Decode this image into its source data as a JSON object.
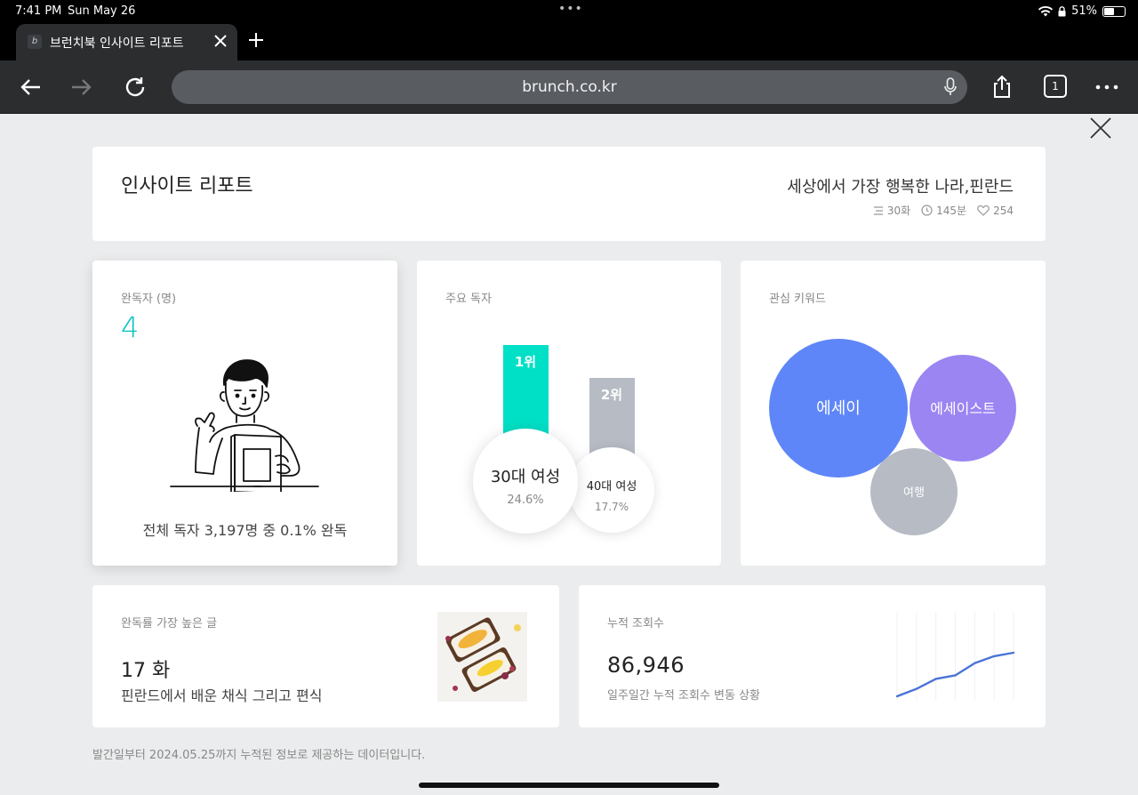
{
  "status": {
    "time": "7:41 PM",
    "date": "Sun May 26",
    "battery": "51%",
    "battery_level": 0.51
  },
  "tab": {
    "title": "브런치북 인사이트 리포트",
    "favicon": "b"
  },
  "toolbar": {
    "url": "brunch.co.kr",
    "tab_count": "1"
  },
  "header": {
    "title": "인사이트 리포트",
    "book_title": "세상에서 가장 행복한 나라,핀란드",
    "episodes": "30화",
    "time": "145분",
    "likes": "254"
  },
  "completion": {
    "label": "완독자 (명)",
    "value": "4",
    "summary": "전체 독자 3,197명 중 0.1% 완독"
  },
  "readers": {
    "label": "주요 독자",
    "rank1": {
      "rank": "1위",
      "group": "30대 여성",
      "percent": "24.6%"
    },
    "rank2": {
      "rank": "2위",
      "group": "40대 여성",
      "percent": "17.7%"
    }
  },
  "keywords": {
    "label": "관심 키워드",
    "items": [
      "에세이",
      "에세이스트",
      "여행"
    ],
    "colors": [
      "#5f86f8",
      "#9b85f2",
      "#b6bbc4"
    ]
  },
  "top_post": {
    "label": "완독률 가장 높은 글",
    "episode": "17 화",
    "title": "핀란드에서 배운 채식 그리고 편식"
  },
  "views": {
    "label": "누적 조회수",
    "value": "86,946",
    "desc": "일주일간 누적 조회수 변동 상황",
    "trend": [
      0.0,
      0.17,
      0.4,
      0.48,
      0.76,
      0.92,
      1.0
    ]
  },
  "footnote": "발간일부터 2024.05.25까지 누적된 정보로 제공하는 데이터입니다.",
  "colors": {
    "accent": "#00c3bd",
    "rank1_bar": "#00e0c6",
    "rank2_bar": "#b6bbc4",
    "spark_line": "#4a74d6"
  }
}
